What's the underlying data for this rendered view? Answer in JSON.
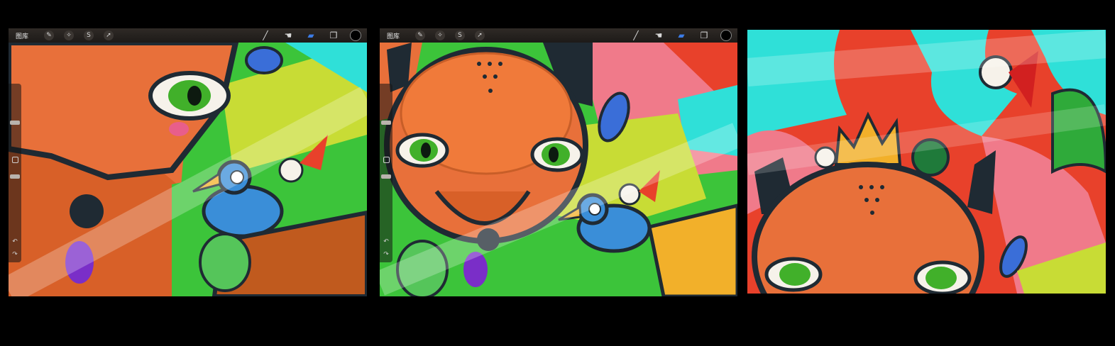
{
  "panels": [
    {
      "toolbar": {
        "gallery_label": "图库",
        "left_tools": [
          "wrench-icon",
          "magic-wand-icon",
          "selection-icon",
          "transform-icon"
        ],
        "right_tools": [
          "brush-icon",
          "smudge-icon",
          "eraser-icon",
          "layers-icon",
          "color-swatch"
        ]
      }
    },
    {
      "toolbar": {
        "gallery_label": "图库",
        "left_tools": [
          "wrench-icon",
          "magic-wand-icon",
          "selection-icon",
          "transform-icon"
        ],
        "right_tools": [
          "brush-icon",
          "smudge-icon",
          "eraser-icon",
          "layers-icon",
          "color-swatch"
        ]
      }
    },
    {}
  ],
  "colors": {
    "fox_orange": "#e8703a",
    "outline": "#1f2a33",
    "eye_green": "#41b02a",
    "bird_blue": "#3a8ed8",
    "cyan_bg": "#2fe0d8",
    "red_bg": "#e8412b",
    "pink_bg": "#f07a8a",
    "yellow_green": "#c8dc35",
    "crown_gold": "#f2b02a",
    "eraser_active": "#3b7be6"
  }
}
